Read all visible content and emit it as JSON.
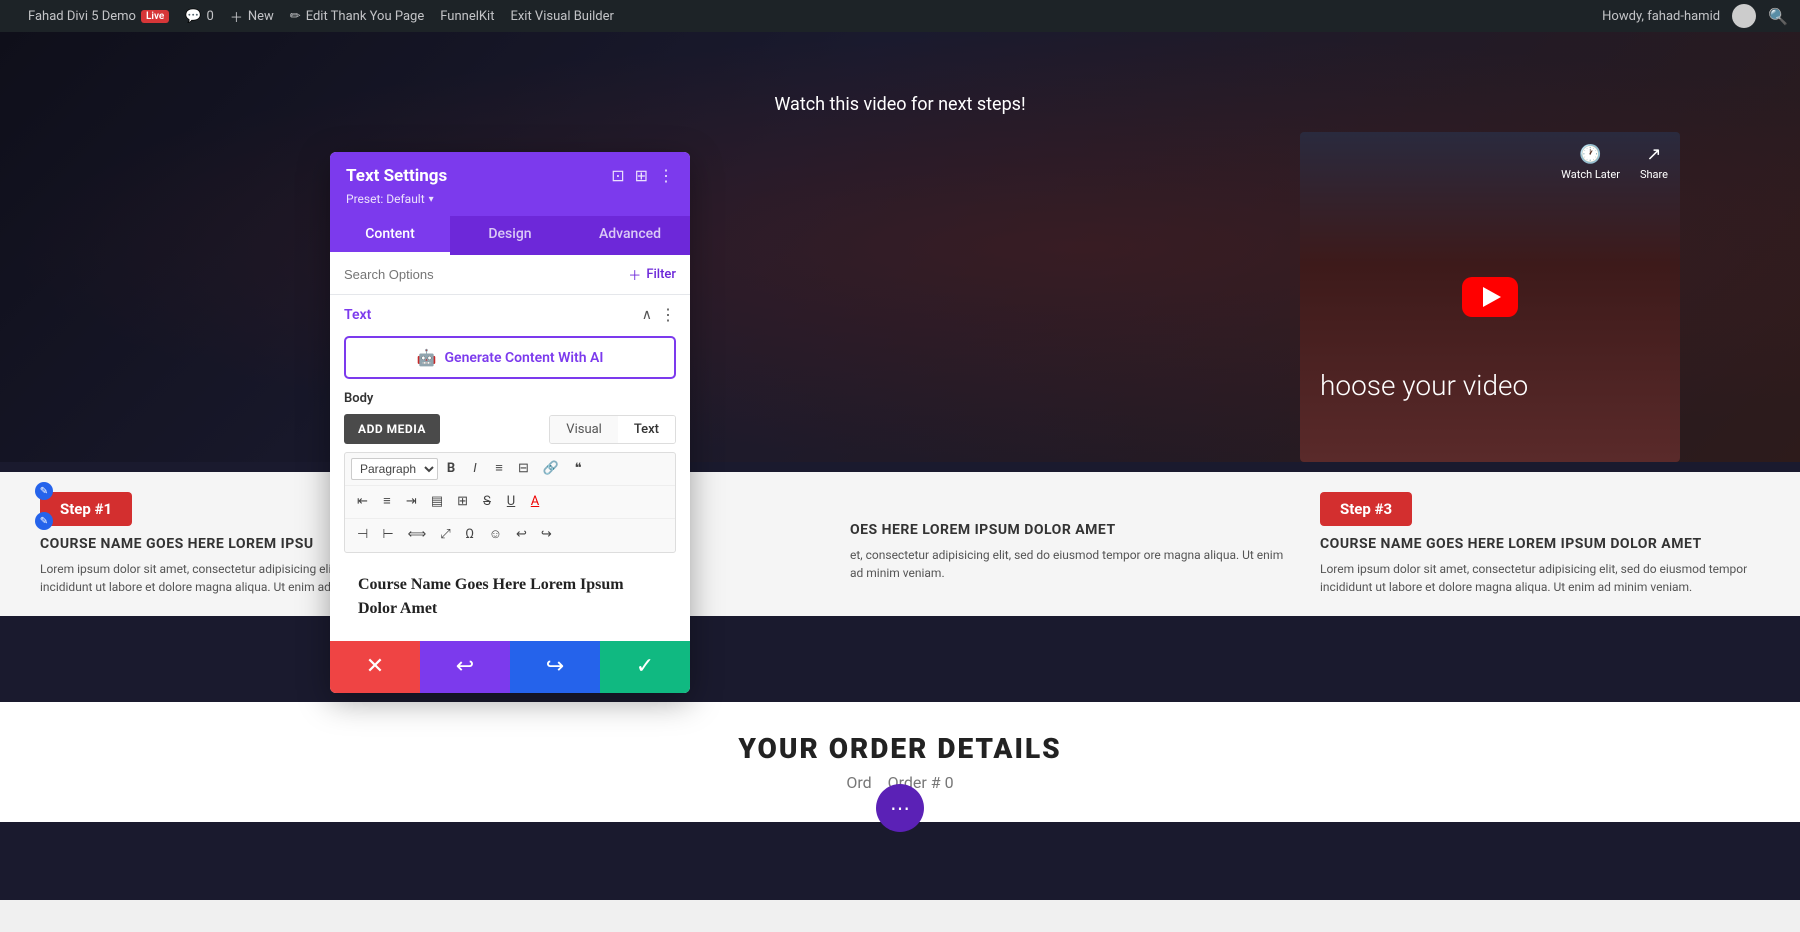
{
  "adminbar": {
    "logo": "wordpress-icon",
    "site_name": "Fahad Divi 5 Demo",
    "live_badge": "Live",
    "comments_icon": "comments-icon",
    "comments_count": "0",
    "new_label": "New",
    "edit_label": "Edit Thank You Page",
    "funnelkit_label": "FunnelKit",
    "visual_builder_label": "Exit Visual Builder",
    "howdy": "Howdy, fahad-hamid",
    "search_icon": "search-icon"
  },
  "hero": {
    "watch_text": "Watch this video for next steps!",
    "video_text": "hoose your video",
    "watch_later": "Watch Later",
    "share": "Share"
  },
  "steps": [
    {
      "badge": "Step #1",
      "title": "COURSE NAME GOES HERE LOREM IPSU",
      "desc": "Lorem ipsum dolor sit amet, consectetur adipisicing elit, sed do eiusmod tempor incididunt ut labore et dolore magna aliqua. Ut enim ad minim veniam."
    },
    {
      "badge": "",
      "title": "OES HERE LOREM IPSUM DOLOR AMET",
      "desc": "et, consectetur adipisicing elit, sed do eiusmod tempor ore magna aliqua. Ut enim ad minim veniam."
    },
    {
      "badge": "Step #3",
      "title": "COURSE NAME GOES HERE LOREM IPSUM DOLOR AMET",
      "desc": "Lorem ipsum dolor sit amet, consectetur adipisicing elit, sed do eiusmod tempor incididunt ut labore et dolore magna aliqua. Ut enim ad minim veniam."
    }
  ],
  "order": {
    "title": "YOUR ORDER DETAILS",
    "number_label": "Order # 0"
  },
  "panel": {
    "title": "Text Settings",
    "preset_label": "Preset: Default",
    "tabs": [
      "Content",
      "Design",
      "Advanced"
    ],
    "active_tab": "Content",
    "search_placeholder": "Search Options",
    "filter_label": "Filter",
    "section_label": "Text",
    "ai_button_label": "Generate Content With AI",
    "body_label": "Body",
    "add_media_label": "ADD MEDIA",
    "visual_tab": "Visual",
    "text_tab": "Text",
    "active_editor_tab": "Text",
    "editor_content": "Course Name Goes Here Lorem Ipsum Dolor Amet",
    "toolbar": {
      "paragraph_label": "Paragraph",
      "bold": "B",
      "italic": "I",
      "ul": "☰",
      "ol": "☰",
      "link": "🔗",
      "quote": "❝",
      "align_left": "≡",
      "align_center": "≡",
      "align_right": "≡",
      "align_justify": "≡",
      "table": "⊞",
      "strikethrough": "S",
      "underline": "U",
      "color": "A",
      "indent_out": "⇤",
      "indent_in": "⇥",
      "special": "Ω",
      "emoji": "☺",
      "undo": "↩",
      "redo": "↪",
      "fullscreen": "⤢"
    }
  },
  "bottom_actions": {
    "cancel_icon": "✕",
    "undo_icon": "↩",
    "redo_icon": "↪",
    "confirm_icon": "✓"
  }
}
